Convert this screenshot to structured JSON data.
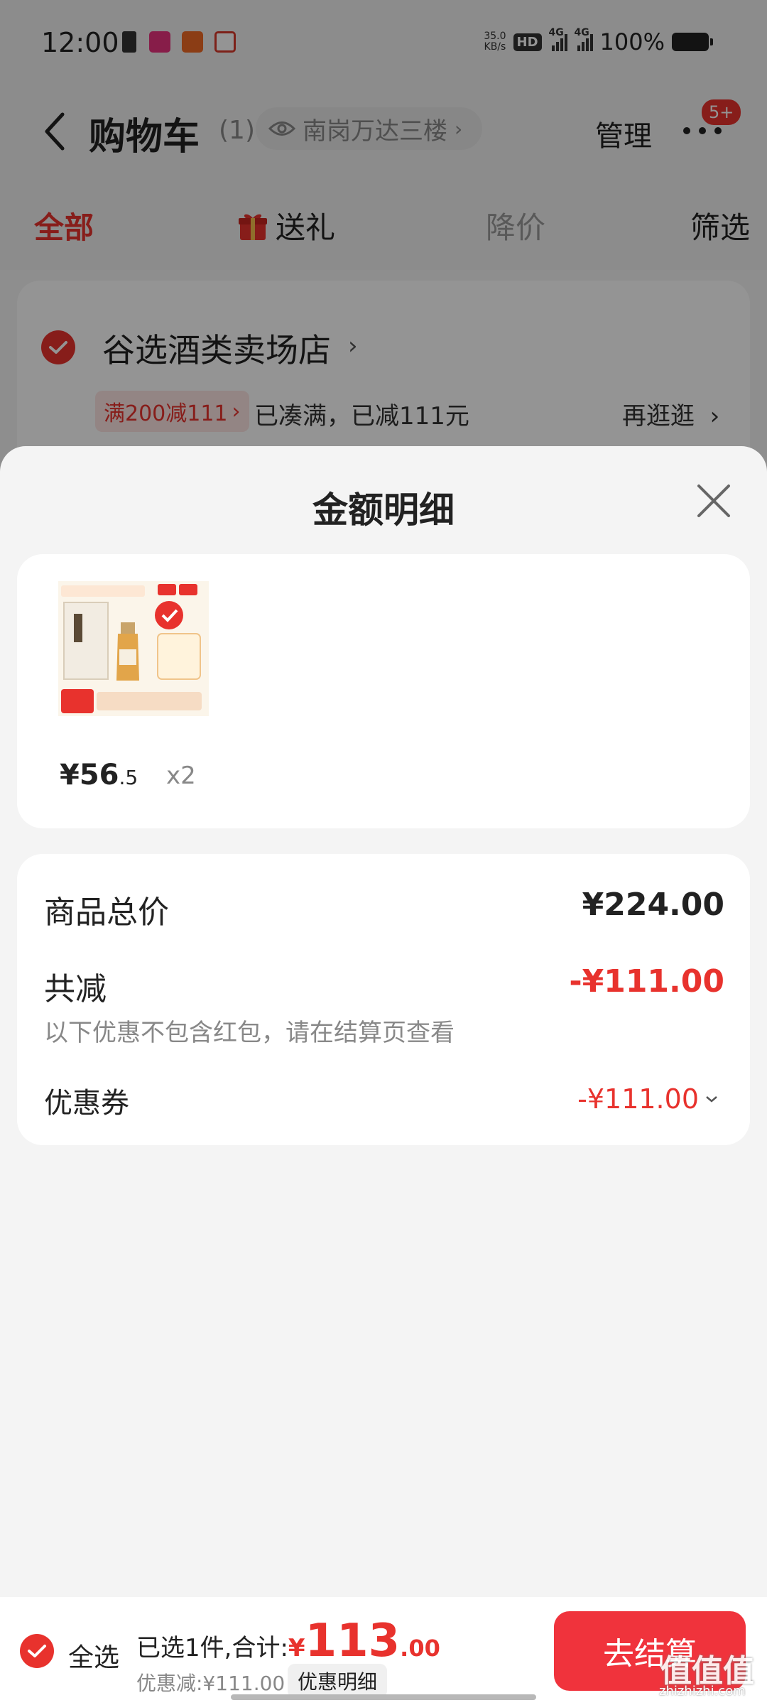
{
  "status_bar": {
    "time": "12:00",
    "net_speed_value": "35.0",
    "net_speed_unit": "KB/s",
    "hd_label": "HD",
    "network_1": "4G",
    "network_2": "4G",
    "battery_percent": "100%"
  },
  "header": {
    "title": "购物车",
    "count": "(1)",
    "location": "南岗万达三楼",
    "manage_label": "管理",
    "badge": "5+"
  },
  "tabs": [
    {
      "label": "全部"
    },
    {
      "label": "送礼"
    },
    {
      "label": "降价"
    },
    {
      "label": "筛选"
    }
  ],
  "store": {
    "name": "谷选酒类卖场店",
    "promo_tag": "满200减111",
    "promo_status": "已凑满，已减111元",
    "browse_more": "再逛逛"
  },
  "sheet": {
    "title": "金额明细",
    "product": {
      "price_int": "¥56",
      "price_dec": ".5",
      "quantity": "x2"
    },
    "summary": {
      "total_label": "商品总价",
      "total_value": "¥224.00",
      "discount_label": "共减",
      "discount_value": "-¥111.00",
      "note": "以下优惠不包含红包，请在结算页查看",
      "coupon_label": "优惠券",
      "coupon_value": "-¥111.00"
    }
  },
  "bottom_bar": {
    "select_all": "全选",
    "selected_text": "已选1件,合计:",
    "currency": "¥",
    "total_int": "113",
    "total_dec": ".00",
    "discount_text": "优惠减:¥111.00",
    "detail_button": "优惠明细",
    "checkout_button": "去结算"
  },
  "watermark": {
    "text": "值值值",
    "site": "zhizhizhi.com"
  },
  "colors": {
    "accent": "#e8322d",
    "checkout": "#f0333c",
    "page_bg": "#f4f4f4"
  }
}
